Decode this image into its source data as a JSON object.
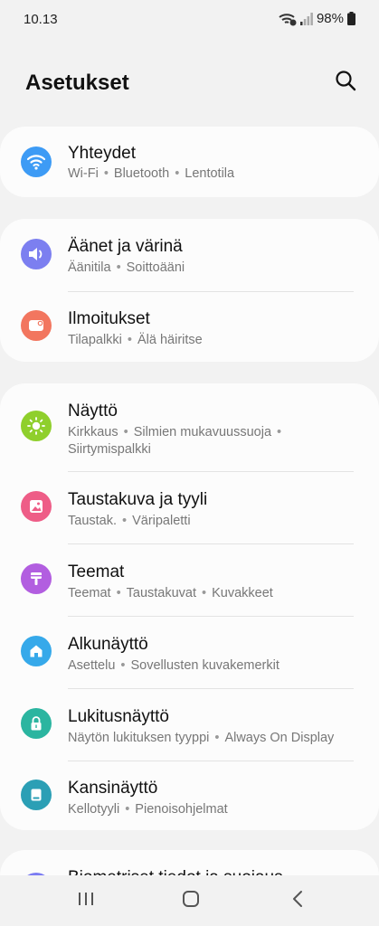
{
  "status_bar": {
    "time": "10.13",
    "battery": "98%",
    "icons": [
      "wifi-calling-icon",
      "signal-icon",
      "battery-icon"
    ]
  },
  "header": {
    "title": "Asetukset",
    "search_icon": "search-icon"
  },
  "groups": [
    {
      "items": [
        {
          "title": "Yhteydet",
          "subtitle": [
            "Wi-Fi",
            "Bluetooth",
            "Lentotila"
          ],
          "icon": "wifi-icon",
          "color": "#3d9bf5"
        }
      ]
    },
    {
      "items": [
        {
          "title": "Äänet ja värinä",
          "subtitle": [
            "Äänitila",
            "Soittoääni"
          ],
          "icon": "speaker-icon",
          "color": "#7c7ff0"
        },
        {
          "title": "Ilmoitukset",
          "subtitle": [
            "Tilapalkki",
            "Älä häiritse"
          ],
          "icon": "notification-icon",
          "color": "#f2765f"
        }
      ]
    },
    {
      "items": [
        {
          "title": "Näyttö",
          "subtitle_line1": [
            "Kirkkaus",
            "Silmien mukavuussuoja",
            ""
          ],
          "subtitle_line2": "Siirtymispalkki",
          "icon": "brightness-icon",
          "color": "#8fcf2c"
        },
        {
          "title": "Taustakuva ja tyyli",
          "subtitle": [
            "Taustak.",
            "Väripaletti"
          ],
          "icon": "wallpaper-icon",
          "color": "#ee5d87"
        },
        {
          "title": "Teemat",
          "subtitle": [
            "Teemat",
            "Taustakuvat",
            "Kuvakkeet"
          ],
          "icon": "themes-icon",
          "color": "#b25ee0"
        },
        {
          "title": "Alkunäyttö",
          "subtitle": [
            "Asettelu",
            "Sovellusten kuvakemerkit"
          ],
          "icon": "home-icon",
          "color": "#36a9ea"
        },
        {
          "title": "Lukitusnäyttö",
          "subtitle": [
            "Näytön lukituksen tyyppi",
            "Always On Display"
          ],
          "icon": "lock-icon",
          "color": "#2bb5a0"
        },
        {
          "title": "Kansinäyttö",
          "subtitle": [
            "Kellotyyli",
            "Pienoisohjelmat"
          ],
          "icon": "cover-screen-icon",
          "color": "#2b9fb5"
        }
      ]
    }
  ],
  "partial_item": {
    "title": "Biometriset tiedot ja suojaus",
    "icon": "biometrics-icon",
    "color": "#7b7cf2"
  },
  "nav_bar": {
    "recents": "recents-icon",
    "home": "home-button-icon",
    "back": "back-icon"
  }
}
